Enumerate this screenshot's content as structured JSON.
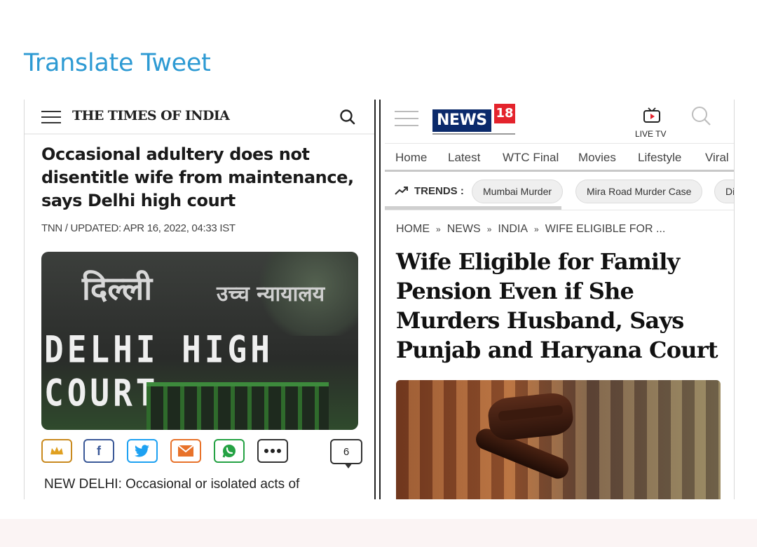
{
  "tweet": {
    "translate_label": "Translate Tweet"
  },
  "toi": {
    "logo": "THE TIMES OF INDIA",
    "headline": "Occasional adultery does not disentitle wife from maintenance, says Delhi high court",
    "meta": "TNN / UPDATED: APR 16, 2022, 04:33 IST",
    "image_text_hindi": "दिल्ली",
    "image_text_hindi2": "उच्च न्यायालय",
    "image_text": "DELHI HIGH COURT",
    "comment_count": "6",
    "body_text": "NEW DELHI: Occasional or isolated acts of",
    "share_icons": [
      "crown-icon",
      "facebook-icon",
      "twitter-icon",
      "email-icon",
      "whatsapp-icon",
      "more-icon"
    ],
    "share_colors": [
      "#c98a1f",
      "#3b5998",
      "#1da1f2",
      "#e8722a",
      "#25a244",
      "#333333"
    ]
  },
  "news18": {
    "logo_text": "NEWS",
    "logo_number": "18",
    "live_tv": "LIVE TV",
    "nav": [
      "Home",
      "Latest",
      "WTC Final",
      "Movies",
      "Lifestyle",
      "Viral"
    ],
    "trends_label": "TRENDS :",
    "trends": [
      "Mumbai Murder",
      "Mira Road Murder Case",
      "Di"
    ],
    "breadcrumb": [
      "HOME",
      "NEWS",
      "INDIA",
      "WIFE ELIGIBLE FOR ..."
    ],
    "breadcrumb_sep": "»",
    "headline": "Wife Eligible for Family Pension Even if She Murders Husband, Says Punjab and Haryana Court",
    "brand_colors": {
      "navy": "#0b2a6b",
      "red": "#e4232c"
    }
  }
}
